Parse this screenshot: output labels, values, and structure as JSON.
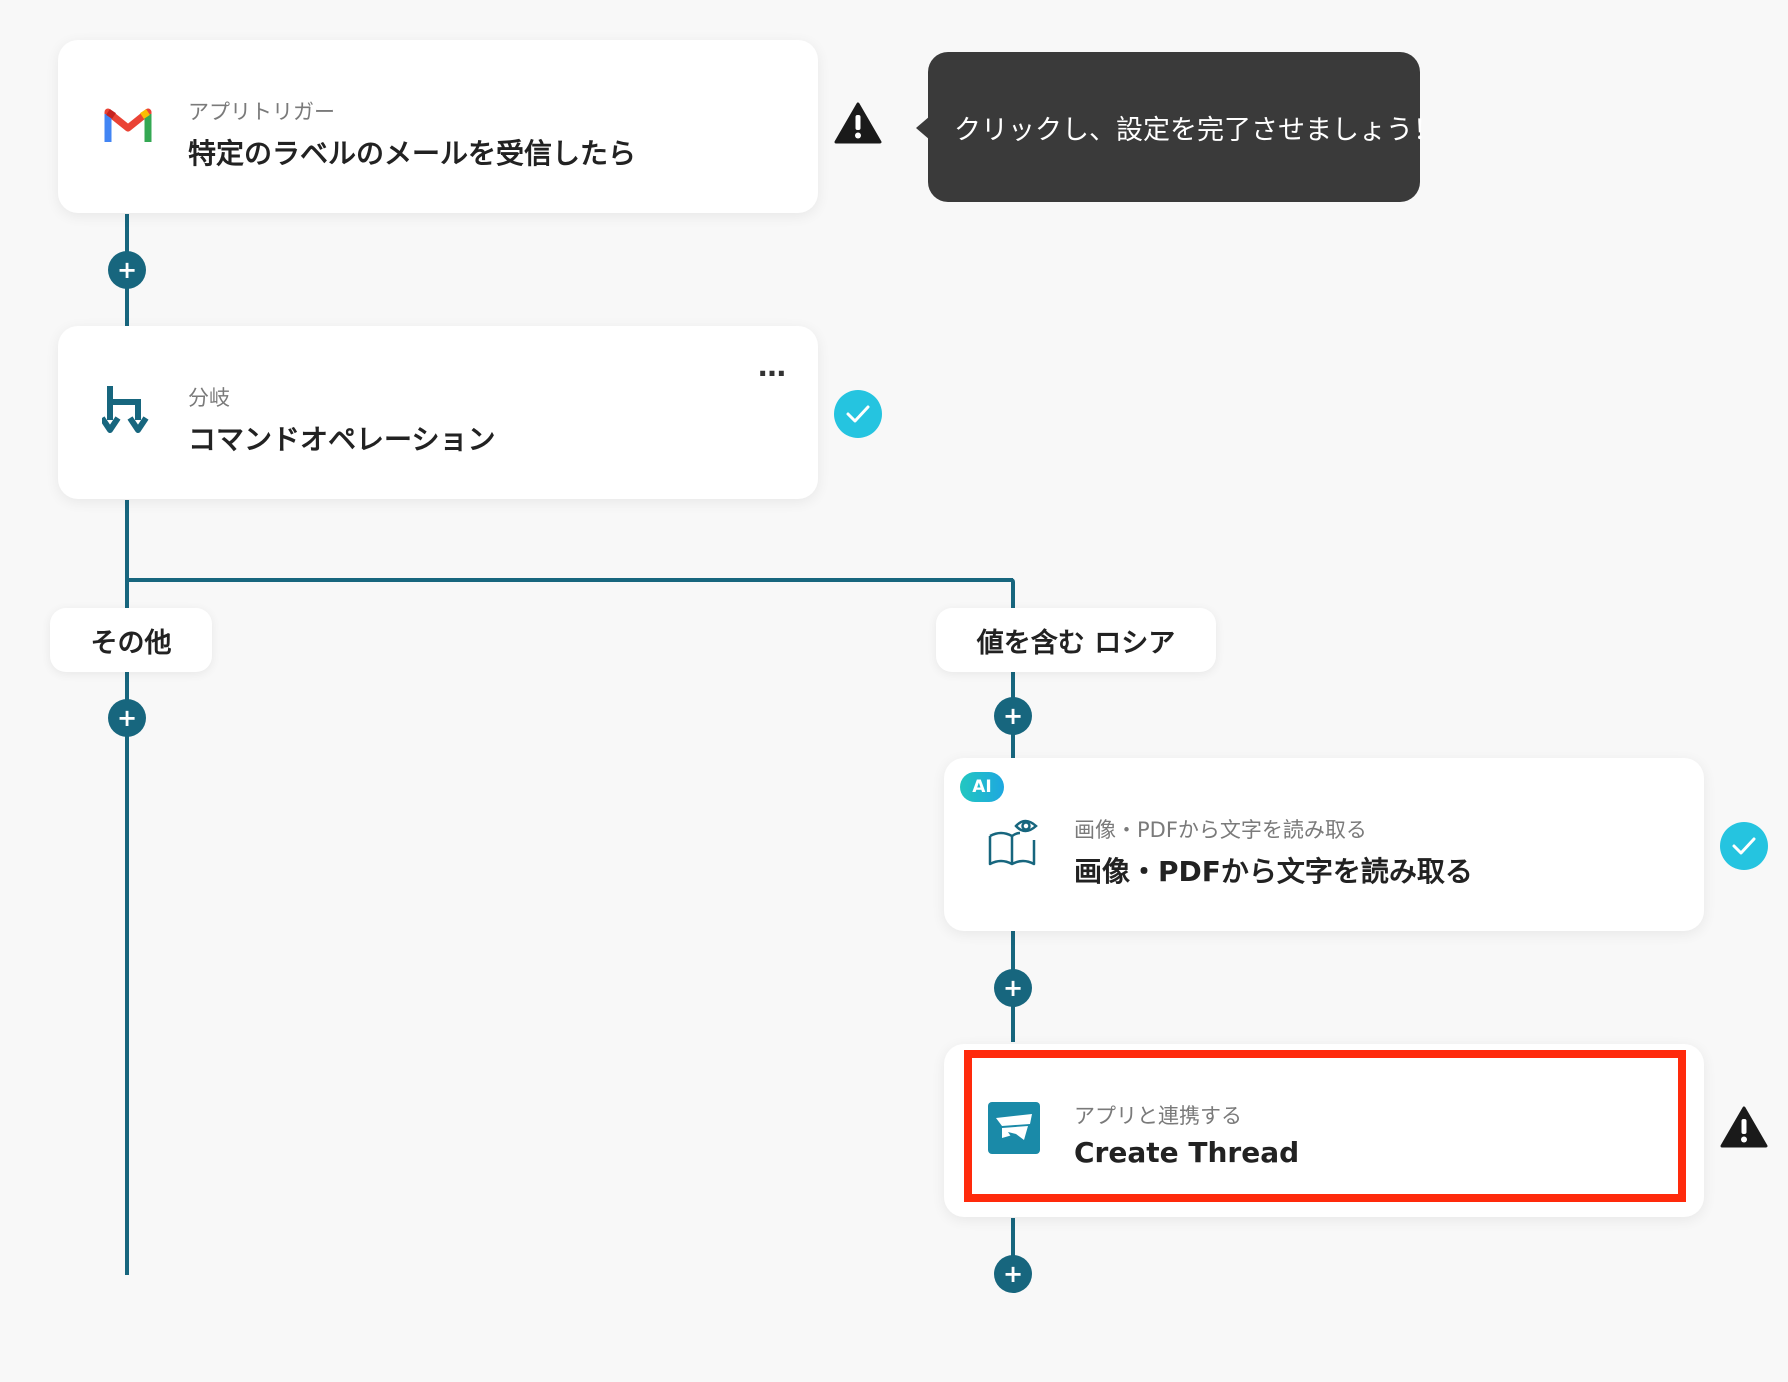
{
  "steps": {
    "trigger": {
      "subtitle": "アプリトリガー",
      "title": "特定のラベルのメールを受信したら",
      "icon": "gmail-icon",
      "status": "warning"
    },
    "branch": {
      "subtitle": "分岐",
      "title": "コマンドオペレーション",
      "icon": "branch-icon",
      "status": "complete",
      "more": "…"
    },
    "ocr": {
      "badge": "AI",
      "subtitle": "画像・PDFから文字を読み取る",
      "title": "画像・PDFから文字を読み取る",
      "icon": "book-eye-icon",
      "status": "complete"
    },
    "app": {
      "subtitle": "アプリと連携する",
      "title": "Create Thread",
      "icon": "app-logo-icon",
      "status": "warning"
    }
  },
  "branches": {
    "left": "その他",
    "right": "値を含む ロシア"
  },
  "tooltip": {
    "text": "クリックし、設定を完了させましょう！"
  },
  "add_step_symbol": "+",
  "colors": {
    "line": "#17667e",
    "highlight": "#ff2a0c",
    "check": "#25c4e0",
    "tooltip_bg": "#3a3a3a"
  }
}
